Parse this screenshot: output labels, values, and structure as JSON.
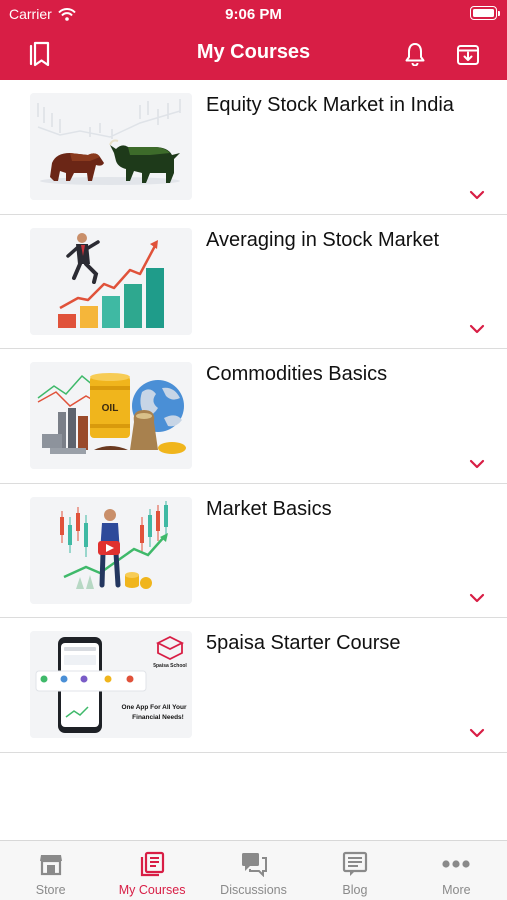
{
  "status_bar": {
    "carrier": "Carrier",
    "time": "9:06 PM"
  },
  "header": {
    "title": "My Courses"
  },
  "courses": [
    {
      "title": "Equity Stock Market in India"
    },
    {
      "title": "Averaging in Stock Market"
    },
    {
      "title": "Commodities Basics"
    },
    {
      "title": "Market Basics"
    },
    {
      "title": "5paisa Starter Course",
      "thumb_text": {
        "brand": "5paisa School",
        "tagline_1": "One App For All Your",
        "tagline_2": "Financial Needs!"
      }
    }
  ],
  "tabs": [
    {
      "label": "Store",
      "icon": "store-icon"
    },
    {
      "label": "My Courses",
      "icon": "courses-icon",
      "active": true
    },
    {
      "label": "Discussions",
      "icon": "discussions-icon"
    },
    {
      "label": "Blog",
      "icon": "blog-icon"
    },
    {
      "label": "More",
      "icon": "more-icon"
    }
  ],
  "colors": {
    "brand": "#d81e45",
    "inactive_tab": "#8a8a8a"
  }
}
